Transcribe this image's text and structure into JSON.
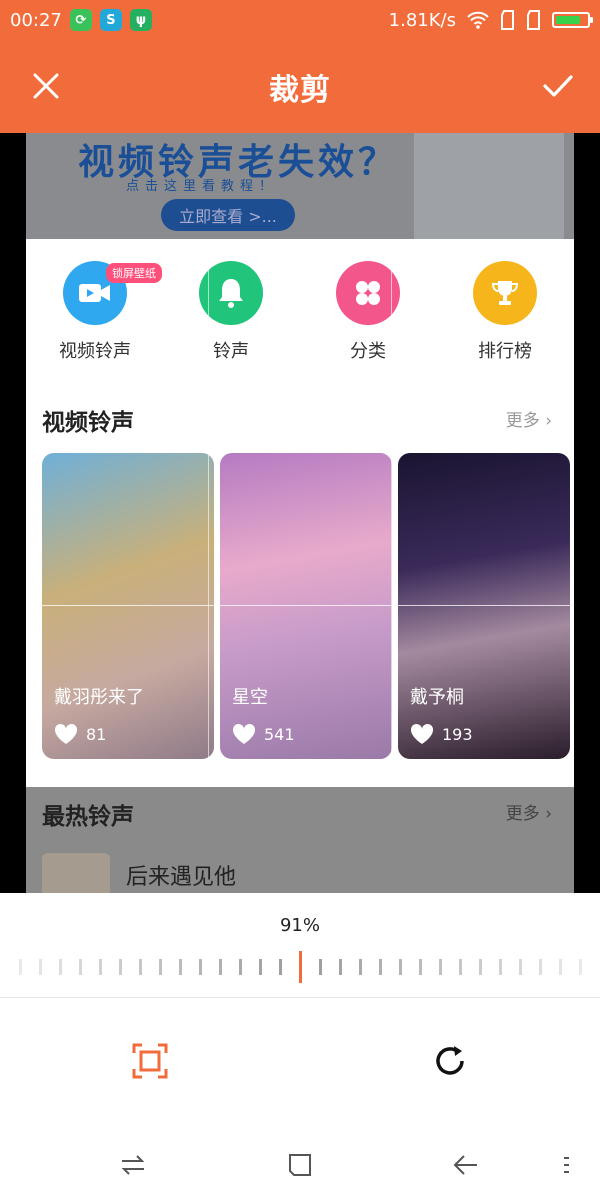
{
  "status_bar": {
    "time": "00:27",
    "net_speed": "1.81K/s",
    "battery_level": 0.8
  },
  "toolbar": {
    "title": "裁剪"
  },
  "screenshot": {
    "banner": {
      "headline": "视频铃声老失效？",
      "sub": "点击这里看教程！",
      "button": "立即查看 >..."
    },
    "categories": [
      {
        "label": "视频铃声",
        "badge": "锁屏壁纸",
        "color": "#2fa8f0",
        "icon": "video-camera-icon"
      },
      {
        "label": "铃声",
        "color": "#20c47a",
        "icon": "bell-icon"
      },
      {
        "label": "分类",
        "color": "#f2568a",
        "icon": "grid-dots-icon"
      },
      {
        "label": "排行榜",
        "color": "#f7b51c",
        "icon": "trophy-icon"
      }
    ],
    "video_section": {
      "title": "视频铃声",
      "more": "更多 ›"
    },
    "cards": [
      {
        "title": "戴羽彤来了",
        "likes": "81"
      },
      {
        "title": "星空",
        "likes": "541"
      },
      {
        "title": "戴予桐",
        "likes": "193"
      }
    ],
    "hot_section": {
      "title": "最热铃声",
      "more": "更多 ›",
      "first_song": "后来遇见他"
    }
  },
  "rotate_control": {
    "value_label": "91%"
  }
}
